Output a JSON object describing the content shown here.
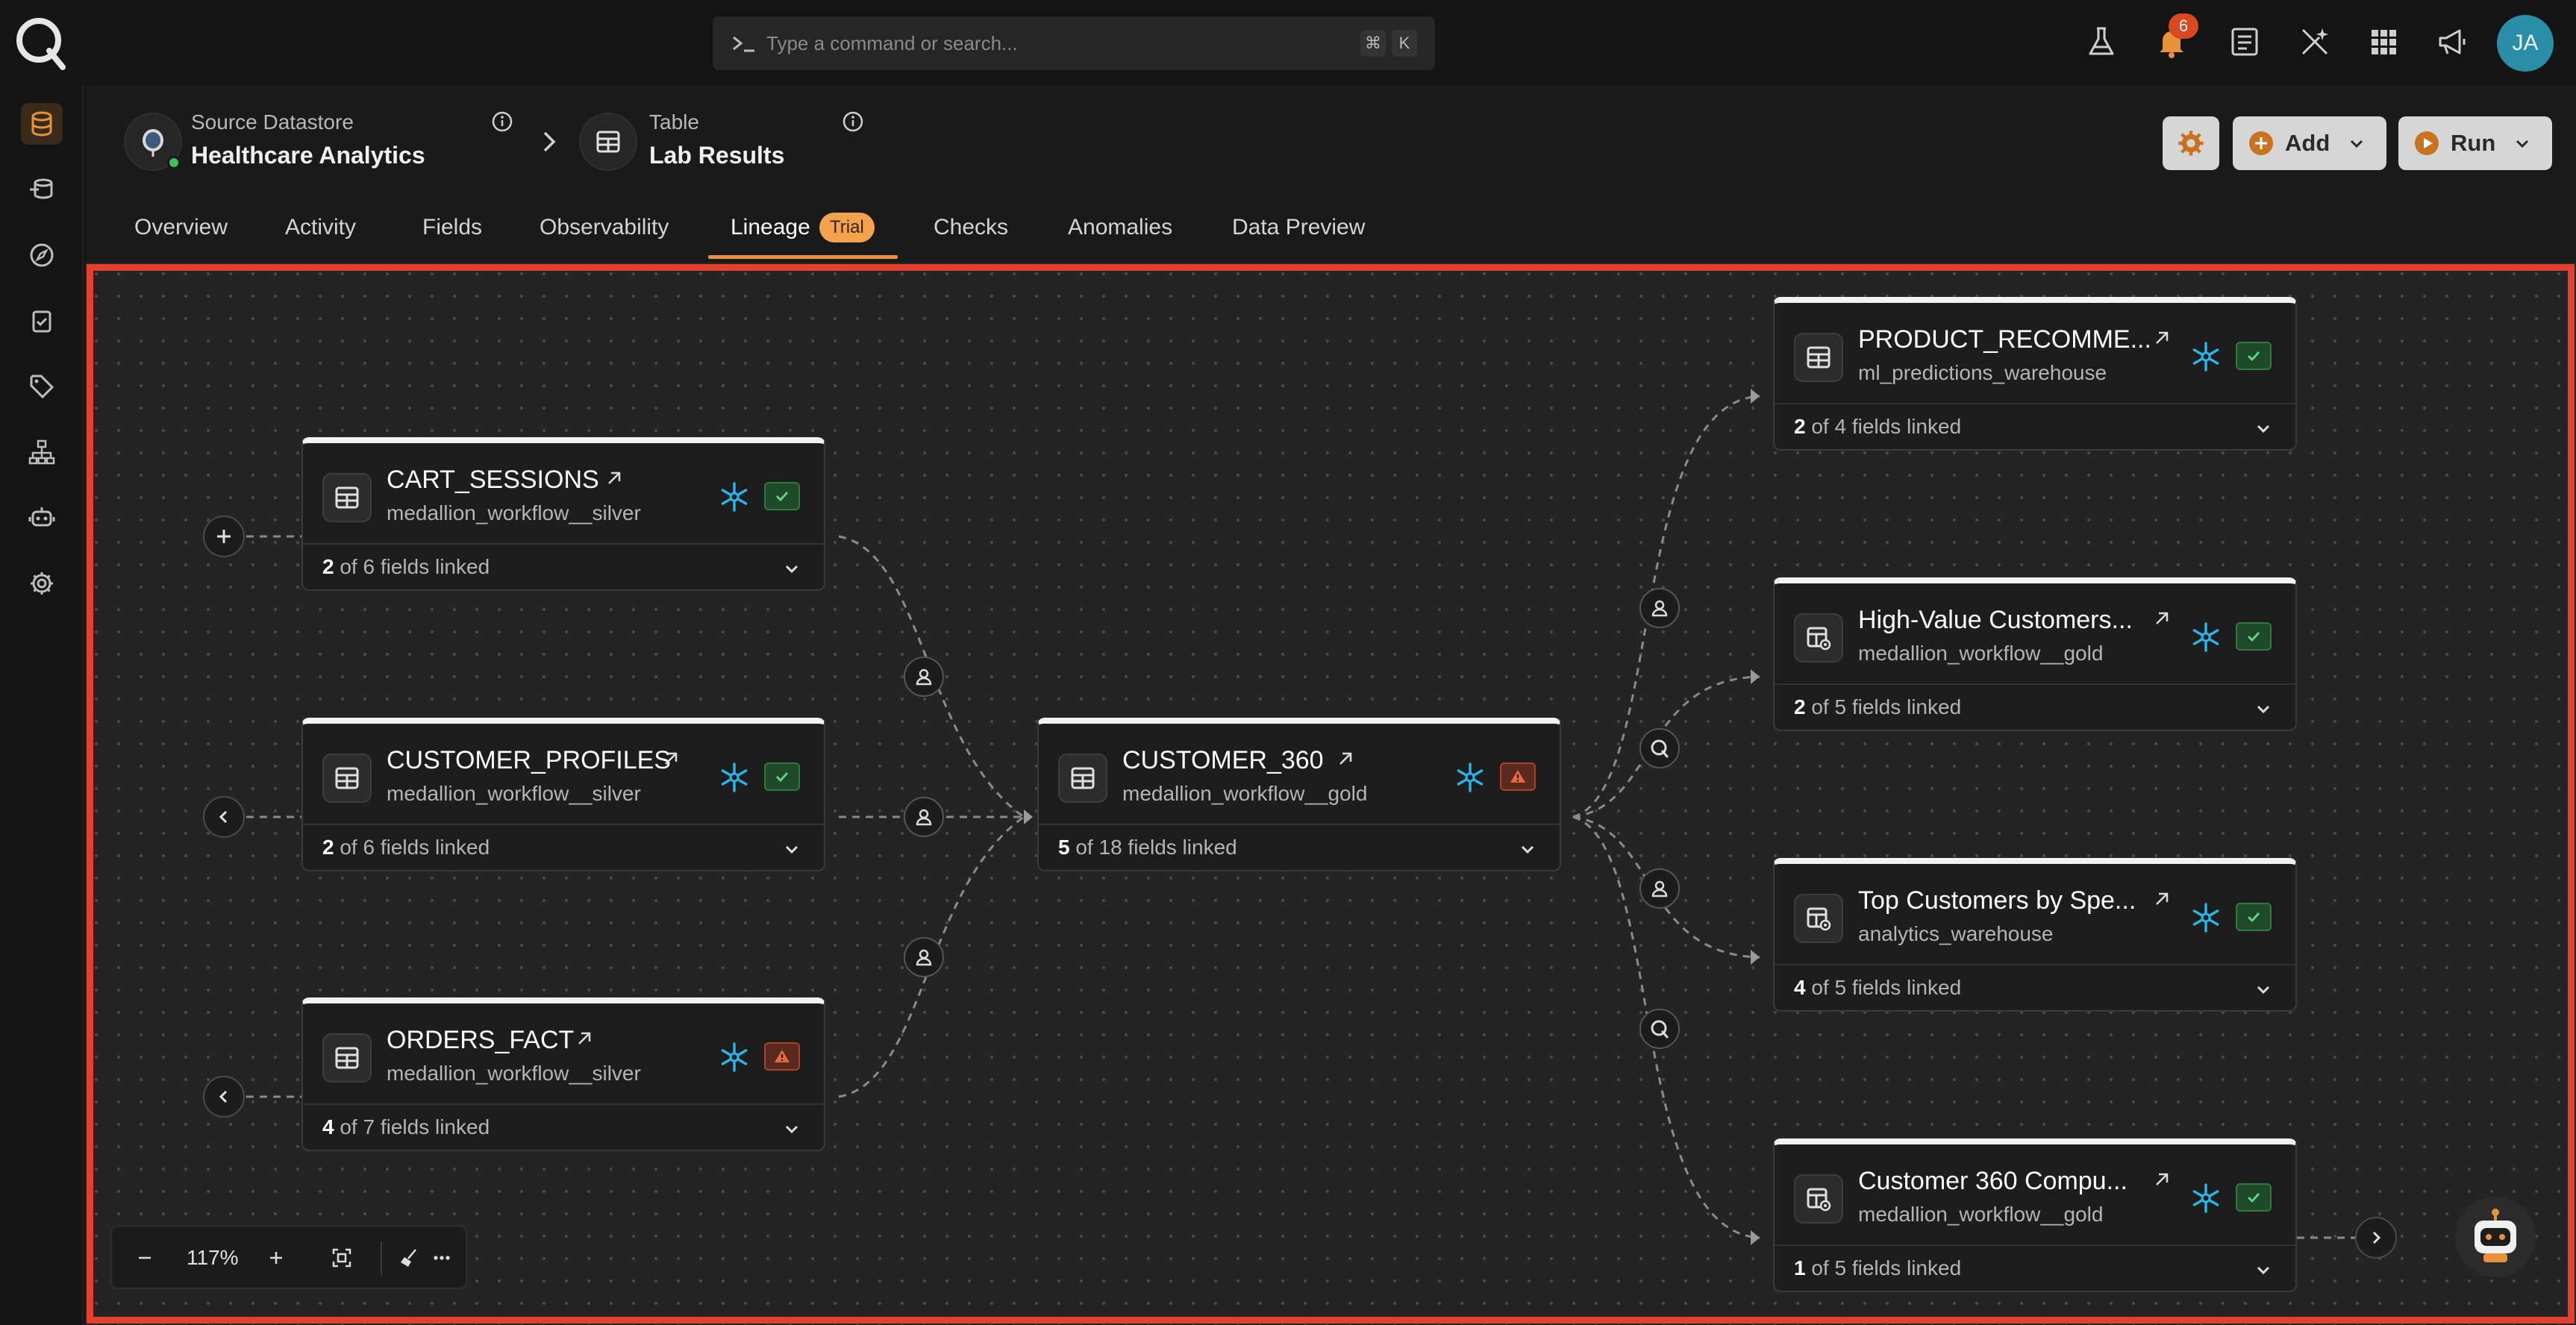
{
  "topbar": {
    "search_placeholder": "Type a command or search...",
    "shortcut_keys": [
      "⌘",
      "K"
    ],
    "notifications_count": "6",
    "user_initials": "JA",
    "icons": [
      "flask-icon",
      "bell-icon",
      "document-icon",
      "magic-wand-icon",
      "apps-grid-icon",
      "megaphone-icon"
    ]
  },
  "rail": {
    "items": [
      "database-icon",
      "data-stack-icon",
      "compass-icon",
      "clipboard-check-icon",
      "tag-icon",
      "hierarchy-icon",
      "robot-icon",
      "settings-icon"
    ],
    "active_index": 0
  },
  "header": {
    "datastore_label": "Source Datastore",
    "datastore_name": "Healthcare Analytics",
    "table_label": "Table",
    "table_name": "Lab Results",
    "add_label": "Add",
    "run_label": "Run"
  },
  "tabs": {
    "items": [
      "Overview",
      "Activity",
      "Fields",
      "Observability",
      "Lineage",
      "Checks",
      "Anomalies",
      "Data Preview"
    ],
    "active": "Lineage",
    "trial_badge": "Trial"
  },
  "lineage": {
    "upstream": [
      {
        "name": "CART_SESSIONS",
        "schema": "medallion_workflow__silver",
        "linked": "2",
        "total": "of 6 fields linked",
        "status": "ok"
      },
      {
        "name": "CUSTOMER_PROFILES",
        "schema": "medallion_workflow__silver",
        "linked": "2",
        "total": "of 6 fields linked",
        "status": "ok"
      },
      {
        "name": "ORDERS_FACT",
        "schema": "medallion_workflow__silver",
        "linked": "4",
        "total": "of 7 fields linked",
        "status": "warn"
      }
    ],
    "center": {
      "name": "CUSTOMER_360",
      "schema": "medallion_workflow__gold",
      "linked": "5",
      "total": "of 18 fields linked",
      "status": "warn"
    },
    "downstream": [
      {
        "name": "PRODUCT_RECOMME...",
        "schema": "ml_predictions_warehouse",
        "linked": "2",
        "total": "of 4 fields linked",
        "status": "ok"
      },
      {
        "name": "High-Value Customers...",
        "schema": "medallion_workflow__gold",
        "linked": "2",
        "total": "of 5 fields linked",
        "status": "ok"
      },
      {
        "name": "Top Customers by Spe...",
        "schema": "analytics_warehouse",
        "linked": "4",
        "total": "of 5 fields linked",
        "status": "ok"
      },
      {
        "name": "Customer 360 Compu...",
        "schema": "medallion_workflow__gold",
        "linked": "1",
        "total": "of 5 fields linked",
        "status": "ok"
      }
    ]
  },
  "zoom": {
    "level": "117%"
  },
  "colors": {
    "accent": "#e8923a",
    "frame": "#e5402e",
    "ok": "#3fbf5a",
    "warn": "#e8683a",
    "snowflake": "#29b5e8"
  }
}
